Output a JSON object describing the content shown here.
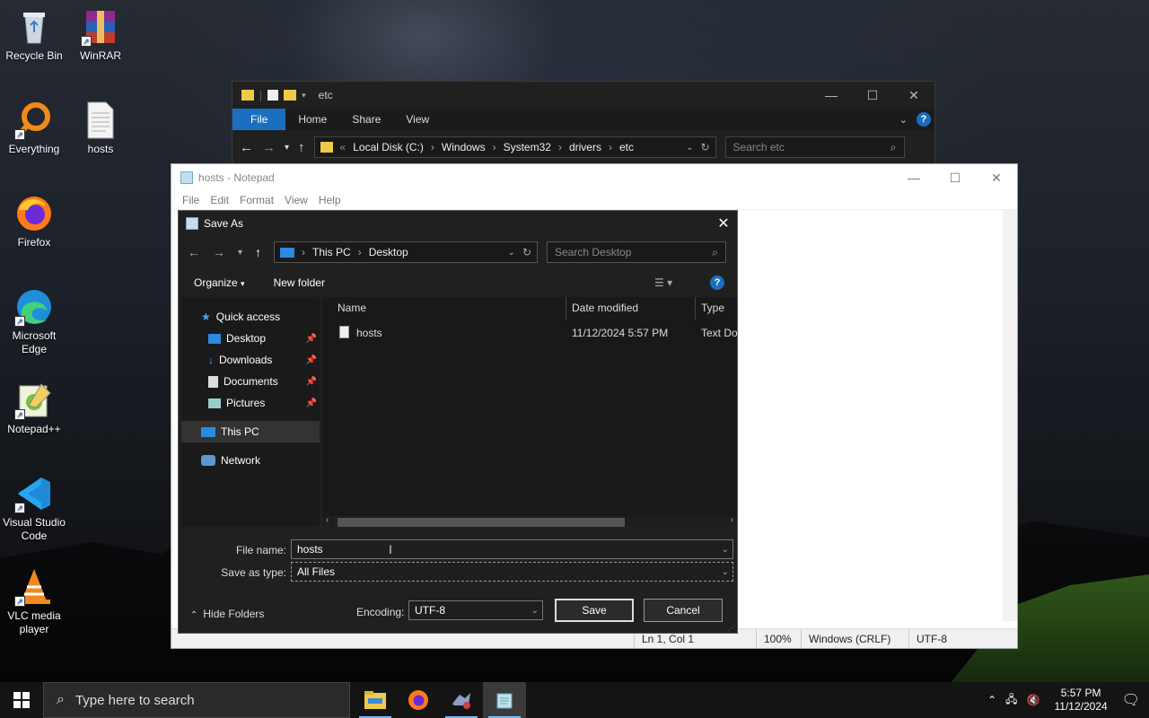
{
  "desktop": {
    "icons": [
      {
        "label": "Recycle Bin"
      },
      {
        "label": "WinRAR"
      },
      {
        "label": "Everything"
      },
      {
        "label": "hosts"
      },
      {
        "label": "Firefox"
      },
      {
        "label": "Microsoft Edge"
      },
      {
        "label": "Notepad++"
      },
      {
        "label": "Visual Studio Code"
      },
      {
        "label": "VLC media player"
      }
    ]
  },
  "explorer": {
    "title": "etc",
    "ribbon_tabs": [
      "File",
      "Home",
      "Share",
      "View"
    ],
    "breadcrumb": [
      "Local Disk (C:)",
      "Windows",
      "System32",
      "drivers",
      "etc"
    ],
    "search_placeholder": "Search etc"
  },
  "notepad": {
    "title": "hosts - Notepad",
    "menu": [
      "File",
      "Edit",
      "Format",
      "View",
      "Help"
    ],
    "status": {
      "position": "Ln 1, Col 1",
      "zoom": "100%",
      "line_ending": "Windows (CRLF)",
      "encoding": "UTF-8"
    }
  },
  "save_dialog": {
    "title": "Save As",
    "breadcrumb": [
      "This PC",
      "Desktop"
    ],
    "search_placeholder": "Search Desktop",
    "organize_label": "Organize",
    "new_folder_label": "New folder",
    "help_label": "?",
    "nav_items": [
      {
        "label": "Quick access"
      },
      {
        "label": "Desktop"
      },
      {
        "label": "Downloads"
      },
      {
        "label": "Documents"
      },
      {
        "label": "Pictures"
      },
      {
        "label": "This PC"
      },
      {
        "label": "Network"
      }
    ],
    "columns": [
      "Name",
      "Date modified",
      "Type"
    ],
    "files": [
      {
        "name": "hosts",
        "date": "11/12/2024 5:57 PM",
        "type": "Text Doc"
      }
    ],
    "file_name_label": "File name:",
    "file_name_value": "hosts",
    "save_type_label": "Save as type:",
    "save_type_value": "All Files",
    "hide_folders_label": "Hide Folders",
    "encoding_label": "Encoding:",
    "encoding_value": "UTF-8",
    "save_label": "Save",
    "cancel_label": "Cancel"
  },
  "taskbar": {
    "search_placeholder": "Type here to search",
    "time": "5:57 PM",
    "date": "11/12/2024"
  },
  "colors": {
    "accent": "#1a6fc0",
    "dialog_bg": "#202020",
    "taskbar_bg": "#141414"
  }
}
